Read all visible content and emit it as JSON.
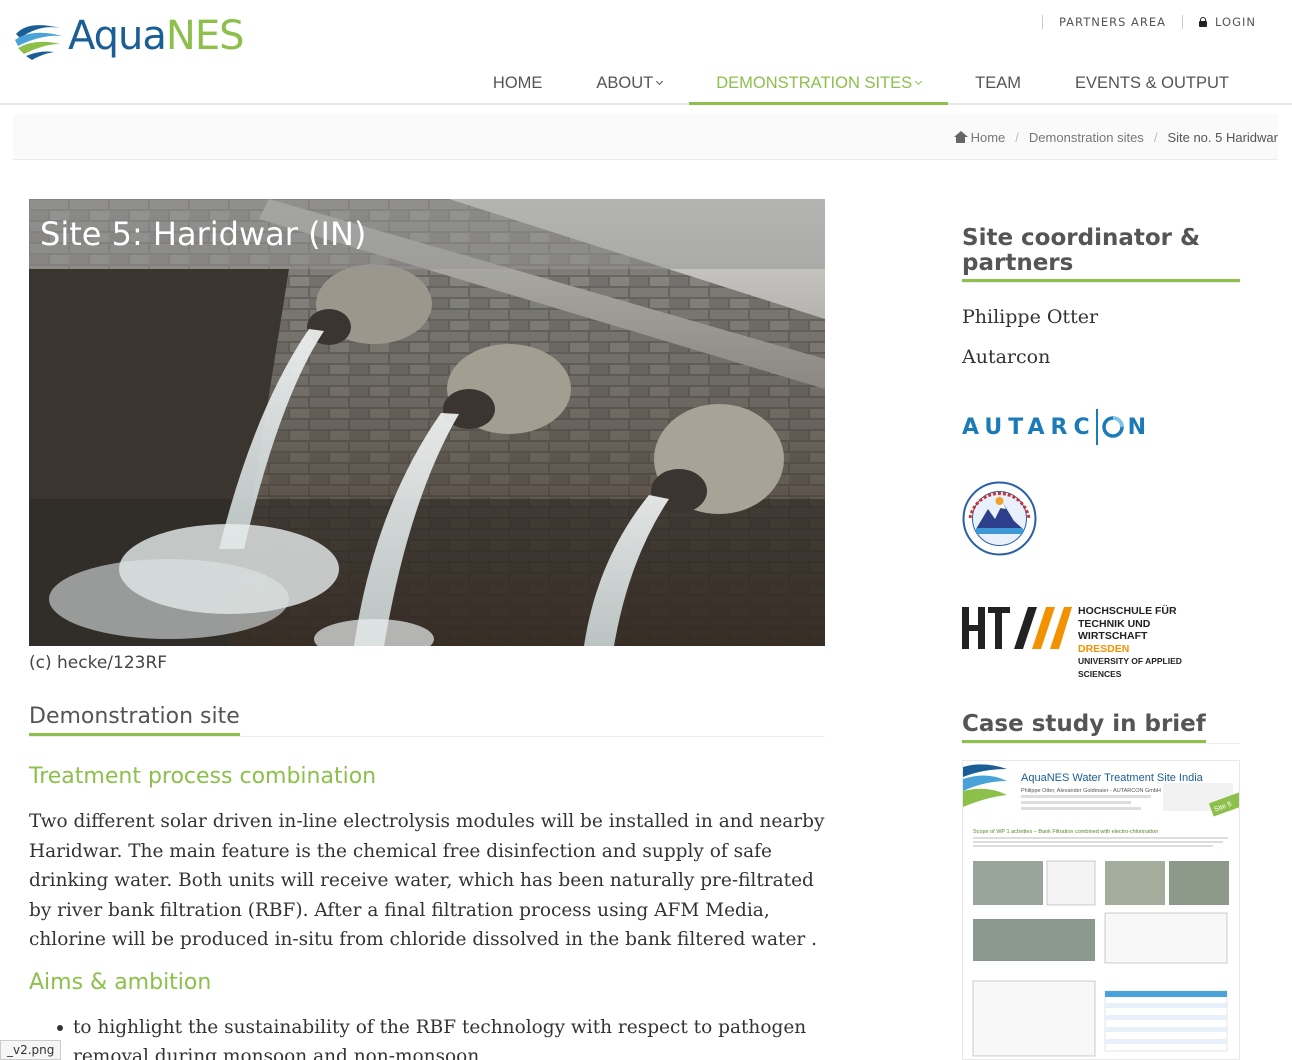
{
  "brand": {
    "name_part1": "Aqua",
    "name_part2": "NES",
    "accent": "#8cc04b",
    "primary": "#1b5e95"
  },
  "toplinks": {
    "partners": "PARTNERS AREA",
    "login": "LOGIN"
  },
  "nav": {
    "items": [
      {
        "label": "HOME"
      },
      {
        "label": "ABOUT"
      },
      {
        "label": "DEMONSTRATION SITES"
      },
      {
        "label": "TEAM"
      },
      {
        "label": "EVENTS & OUTPUT"
      }
    ],
    "active_index": 2
  },
  "breadcrumb": {
    "home": "Home",
    "section": "Demonstration sites",
    "current": "Site no. 5 Haridwar"
  },
  "hero": {
    "title": "Site 5: Haridwar (IN)",
    "caption": "(c) hecke/123RF"
  },
  "main": {
    "section_title": "Demonstration site",
    "treatment_title": "Treatment process combination",
    "treatment_text": "Two different solar driven in-line electrolysis modules will be installed in and nearby Haridwar. The main feature is the chemical free disinfection and supply of safe drinking water. Both units will receive water, which has been naturally pre-filtrated by river bank filtration (RBF). After a final filtration process using AFM Media, chlorine will be produced in-situ from chloride dissolved in the bank filtered water .",
    "aims_title": "Aims & ambition",
    "aims": [
      "to highlight the sustainability of the RBF technology with respect to pathogen removal during monsoon and non-monsoon"
    ]
  },
  "sidebar": {
    "coordinator_title": "Site coordinator & partners",
    "people": [
      "Philippe Otter",
      "Autarcon"
    ],
    "logos": {
      "autarcon": "AUTARC",
      "autarcon_tail": "N",
      "htw_lines": [
        "HOCHSCHULE FÜR",
        "TECHNIK UND WIRTSCHAFT",
        "DRESDEN",
        "UNIVERSITY OF APPLIED SCIENCES"
      ]
    },
    "case_title": "Case study in brief",
    "case_doc": {
      "title": "AquaNES Water Treatment Site India",
      "authors": "Philippe Otter, Alexander Goldmaier - AUTARCON GmbH",
      "badge": "Site 5",
      "heading": "Scope of WP 1 activities – Bank Filtration combined with electro-chlorination"
    }
  },
  "filetag": "_v2.png"
}
